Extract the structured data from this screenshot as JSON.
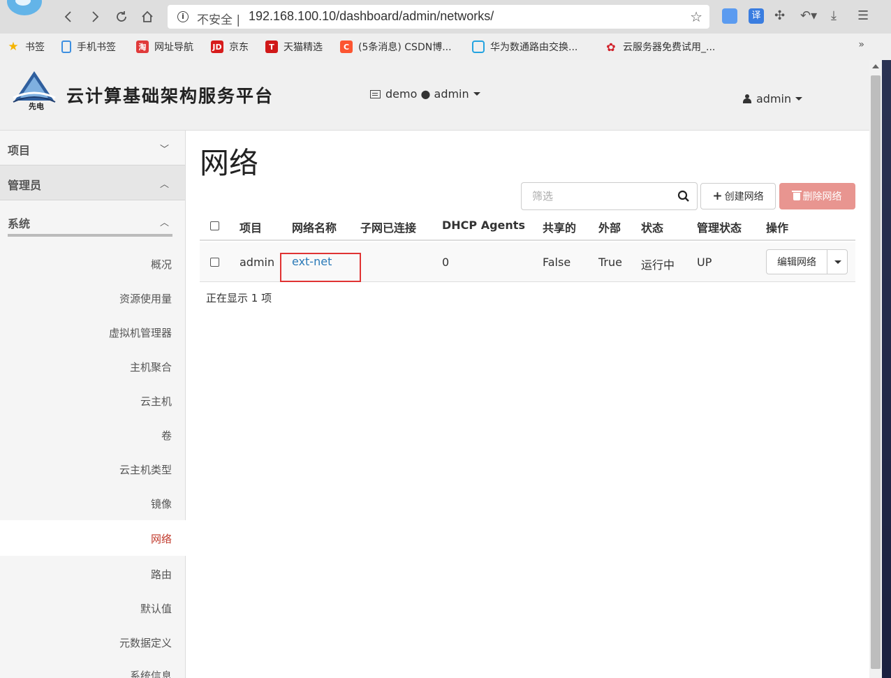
{
  "browser": {
    "insecure_label": "不安全 |",
    "url": "192.168.100.10/dashboard/admin/networks/",
    "bookmarks": [
      {
        "label": "书签",
        "icon": "star-icon",
        "color": "#f5b400"
      },
      {
        "label": "手机书签",
        "icon": "phone-icon",
        "color": "#3d8fe0"
      },
      {
        "label": "网址导航",
        "icon": "nav-icon",
        "color": "#e03a3a"
      },
      {
        "label": "京东",
        "icon": "jd-icon",
        "color": "#d71c1c"
      },
      {
        "label": "天猫精选",
        "icon": "tmall-icon",
        "color": "#d01818"
      },
      {
        "label": "(5条消息) CSDN博...",
        "icon": "csdn-icon",
        "color": "#fc5531"
      },
      {
        "label": "华为数通路由交换...",
        "icon": "bilibili-icon",
        "color": "#23a3e0"
      },
      {
        "label": "云服务器免费试用_...",
        "icon": "huawei-icon",
        "color": "#d12029"
      }
    ],
    "more": "»"
  },
  "header": {
    "brand": "云计算基础架构服务平台",
    "logo_text": "先电",
    "context": "demo ● admin",
    "user": "admin"
  },
  "sidebar": {
    "sections": [
      "项目",
      "管理员",
      "系统"
    ],
    "items": [
      "概况",
      "资源使用量",
      "虚拟机管理器",
      "主机聚合",
      "云主机",
      "卷",
      "云主机类型",
      "镜像",
      "网络",
      "路由",
      "默认值",
      "元数据定义",
      "系统信息"
    ],
    "active": "网络"
  },
  "main": {
    "title": "网络",
    "filter_placeholder": "筛选",
    "create_button": "创建网络",
    "delete_button": "删除网络",
    "columns": [
      "项目",
      "网络名称",
      "子网已连接",
      "DHCP Agents",
      "共享的",
      "外部",
      "状态",
      "管理状态",
      "操作"
    ],
    "rows": [
      {
        "project": "admin",
        "name": "ext-net",
        "subnets": "",
        "dhcp_agents": "0",
        "shared": "False",
        "external": "True",
        "status": "运行中",
        "admin_state": "UP",
        "action": "编辑网络"
      }
    ],
    "footer": "正在显示 1 项"
  },
  "colors": {
    "active_item": "#c0392b",
    "link": "#2a7ab8",
    "delete_button": "#e89590",
    "highlight_box": "#e03333"
  }
}
